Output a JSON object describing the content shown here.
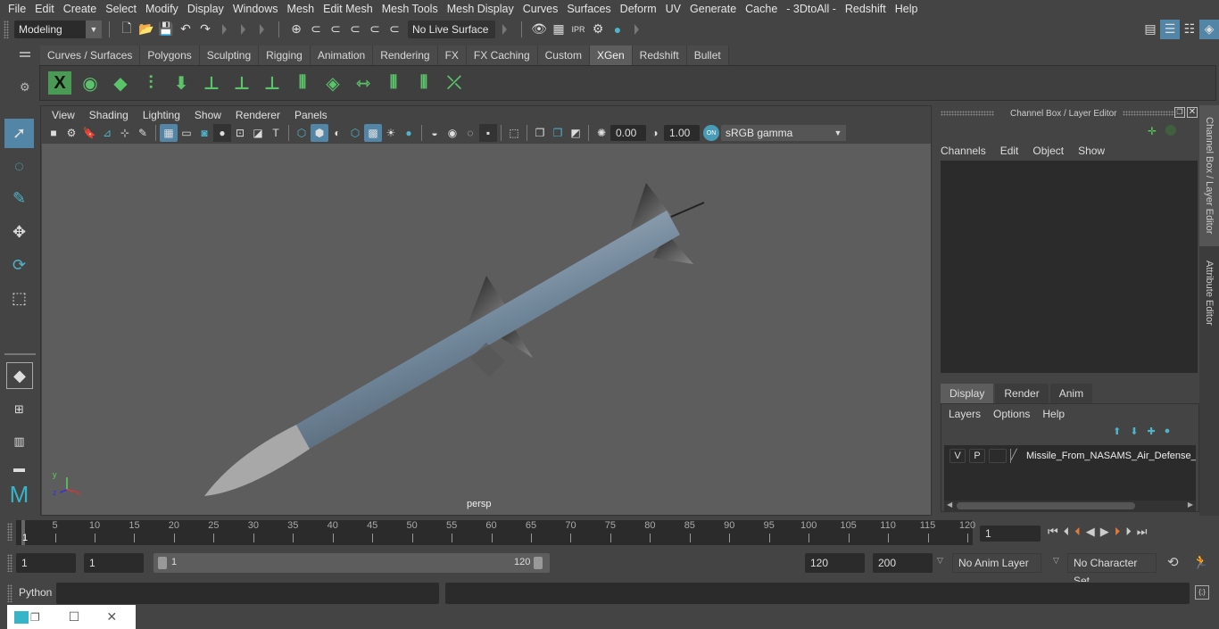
{
  "menubar": [
    "File",
    "Edit",
    "Create",
    "Select",
    "Modify",
    "Display",
    "Windows",
    "Mesh",
    "Edit Mesh",
    "Mesh Tools",
    "Mesh Display",
    "Curves",
    "Surfaces",
    "Deform",
    "UV",
    "Generate",
    "Cache",
    "- 3DtoAll -",
    "Redshift",
    "Help"
  ],
  "status": {
    "mode": "Modeling",
    "live_surface": "No Live Surface"
  },
  "shelf": {
    "tabs": [
      "Curves / Surfaces",
      "Polygons",
      "Sculpting",
      "Rigging",
      "Animation",
      "Rendering",
      "FX",
      "FX Caching",
      "Custom",
      "XGen",
      "Redshift",
      "Bullet"
    ],
    "active_tab": "XGen",
    "icons": [
      "xgen-editor-icon",
      "create-description-icon",
      "delete-description-icon",
      "add-guide-icon",
      "place-guide-icon",
      "add-guide-stroke-icon",
      "select-guide-icon",
      "lock-guide-icon",
      "rebuild-guides-icon",
      "create-interactive-groom-icon",
      "sculpt-guide-icon",
      "cut-guide-icon",
      "select-guides-icon",
      "delete-guide-icon"
    ]
  },
  "viewport": {
    "menu": [
      "View",
      "Shading",
      "Lighting",
      "Show",
      "Renderer",
      "Panels"
    ],
    "exposure": "0.00",
    "gamma": "1.00",
    "color_space": "sRGB gamma",
    "camera_label": "persp",
    "axis": {
      "x": "x",
      "y": "y",
      "z": "z"
    }
  },
  "channel_box": {
    "title": "Channel Box / Layer Editor",
    "menu": [
      "Channels",
      "Edit",
      "Object",
      "Show"
    ]
  },
  "layer_editor": {
    "tabs": [
      "Display",
      "Render",
      "Anim"
    ],
    "active_tab": "Display",
    "menu": [
      "Layers",
      "Options",
      "Help"
    ],
    "layers": [
      {
        "v": "V",
        "p": "P",
        "name": "Missile_From_NASAMS_Air_Defense_S"
      }
    ]
  },
  "side_tabs": [
    "Channel Box / Layer Editor",
    "Attribute Editor"
  ],
  "timeline": {
    "ticks": [
      5,
      10,
      15,
      20,
      25,
      30,
      35,
      40,
      45,
      50,
      55,
      60,
      65,
      70,
      75,
      80,
      85,
      90,
      95,
      100,
      105,
      110,
      115,
      120
    ],
    "start_marker": "1",
    "min": 1,
    "max": 120,
    "current_frame": "1"
  },
  "range": {
    "start": "1",
    "playback_start": "1",
    "slider_start": "1",
    "slider_end": "120",
    "playback_end": "120",
    "end": "200",
    "anim_layer": "No Anim Layer",
    "character_set": "No Character Set"
  },
  "command_line": {
    "label": "Python",
    "value": ""
  },
  "colors": {
    "accent": "#5285a6",
    "shelf_icon": "#5bc46a",
    "key_marker": "#e07b39"
  }
}
